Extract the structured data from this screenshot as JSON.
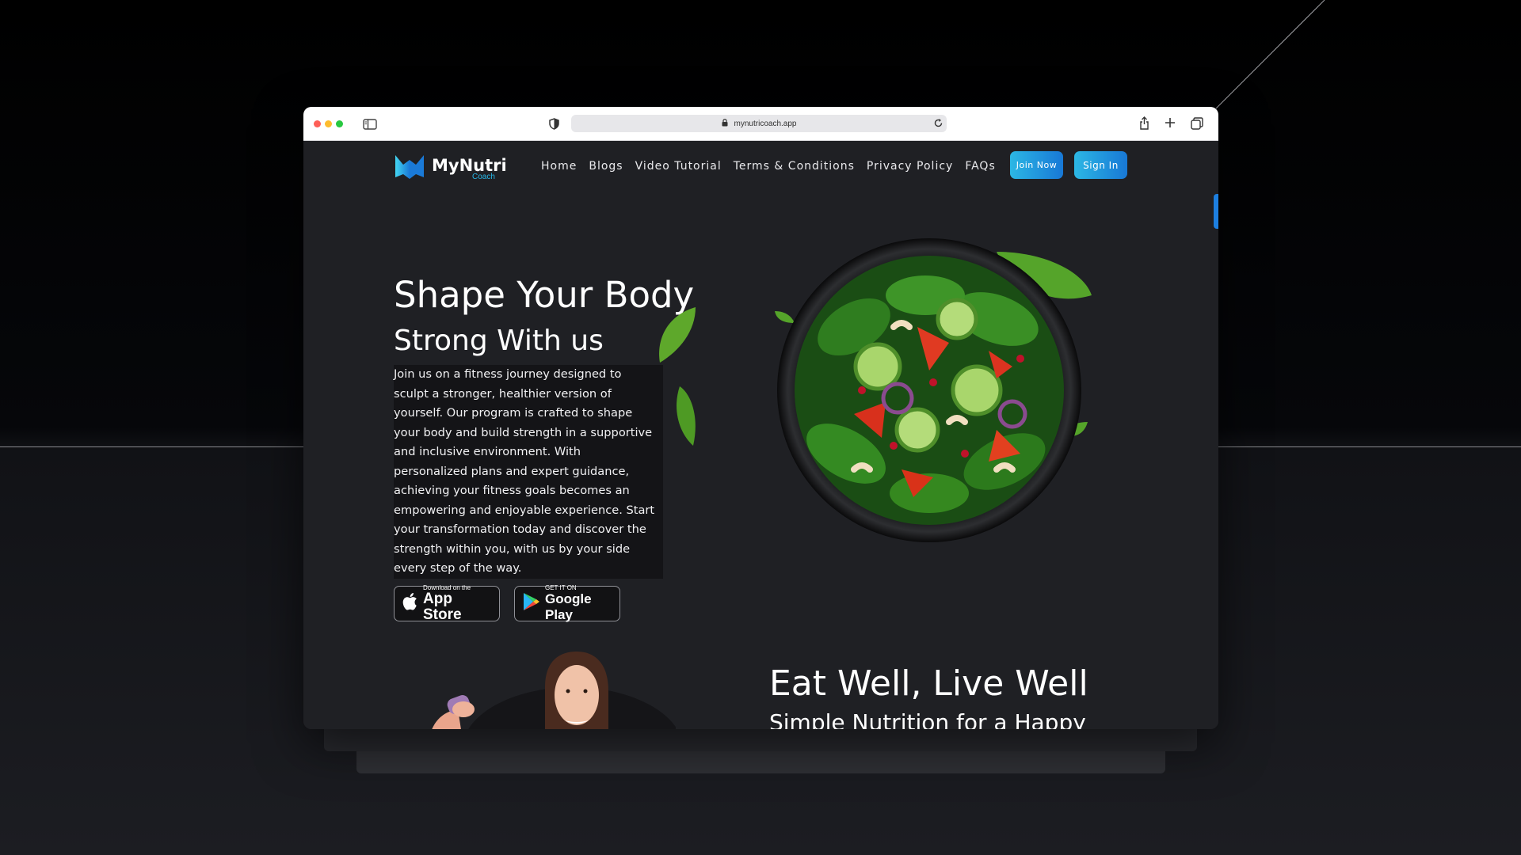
{
  "browser": {
    "url": "mynutricoach.app"
  },
  "brand": {
    "name": "MyNutri",
    "tagline": "Coach"
  },
  "nav": {
    "links": [
      "Home",
      "Blogs",
      "Video Tutorial",
      "Terms & Conditions",
      "Privacy Policy",
      "FAQs"
    ],
    "join_label": "Join Now",
    "signin_label": "Sign In"
  },
  "hero": {
    "title": "Shape Your Body",
    "subtitle": "Strong With us",
    "description": "Join us on a fitness journey designed to sculpt a stronger, healthier version of yourself. Our program is crafted to shape your body and build strength in a supportive and inclusive environment. With personalized plans and expert guidance, achieving your fitness goals becomes an empowering and enjoyable experience. Start your transformation today and discover the strength within you, with us by your side every step of the way."
  },
  "stores": {
    "apple_small": "Download on the",
    "apple_big": "App Store",
    "google_small": "GET IT ON",
    "google_big": "Google Play"
  },
  "section2": {
    "title": "Eat Well, Live Well",
    "subtitle": "Simple Nutrition for a Happy"
  },
  "colors": {
    "accent_start": "#2cb7e4",
    "accent_end": "#1878d6",
    "page_bg": "#1f2024"
  },
  "icons": [
    "sidebar-icon",
    "shield-icon",
    "lock-icon",
    "reload-icon",
    "share-icon",
    "new-tab-icon",
    "tabs-icon",
    "apple-icon",
    "google-play-icon"
  ]
}
